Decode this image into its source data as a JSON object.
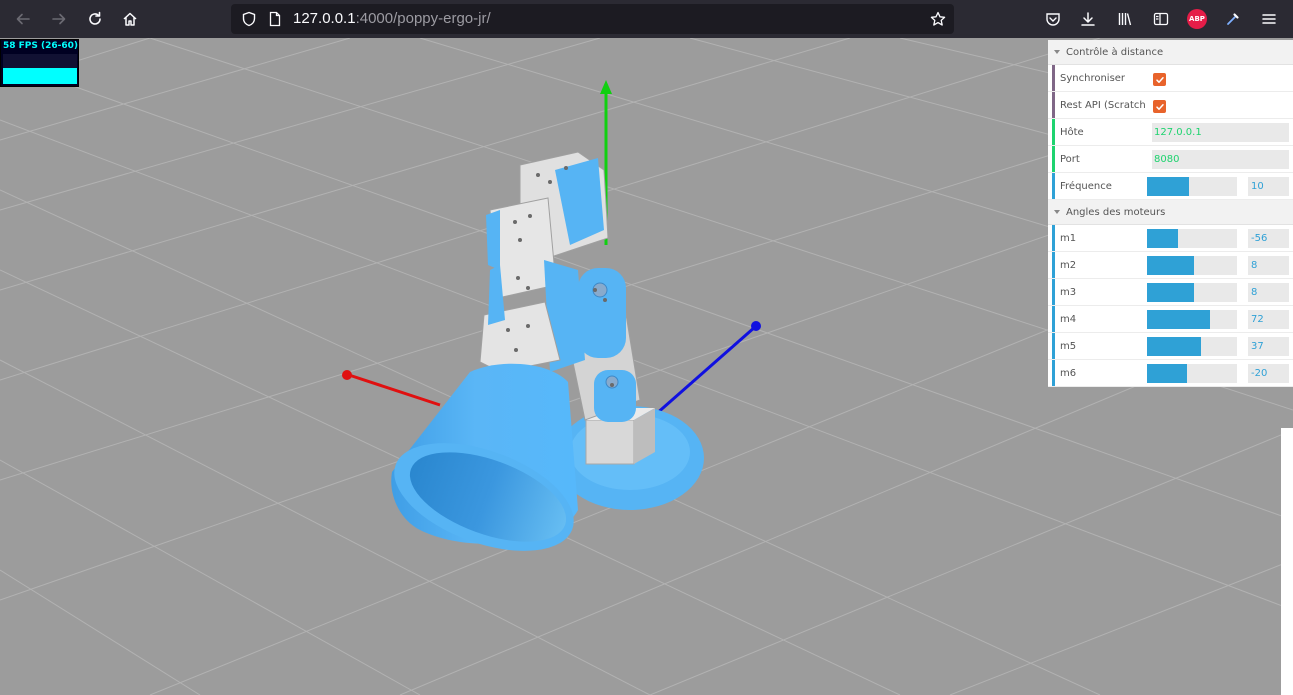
{
  "browser": {
    "url_host": "127.0.0.1",
    "url_rest": ":4000/poppy-ergo-jr/",
    "abp_label": "ABP"
  },
  "stats": {
    "fps_label": "58 FPS (26-60)"
  },
  "gui": {
    "remote_folder": {
      "title": "Contrôle à distance",
      "sync_label": "Synchroniser",
      "sync_checked": true,
      "rest_label": "Rest API (Scratch",
      "rest_checked": true,
      "host_label": "Hôte",
      "host_value": "127.0.0.1",
      "port_label": "Port",
      "port_value": "8080",
      "freq_label": "Fréquence",
      "freq_value": "10",
      "freq_fraction": 0.47
    },
    "motors_folder": {
      "title": "Angles des moteurs",
      "motors": [
        {
          "label": "m1",
          "value": "-56",
          "fraction": 0.34
        },
        {
          "label": "m2",
          "value": "8",
          "fraction": 0.52
        },
        {
          "label": "m3",
          "value": "8",
          "fraction": 0.52
        },
        {
          "label": "m4",
          "value": "72",
          "fraction": 0.7
        },
        {
          "label": "m5",
          "value": "37",
          "fraction": 0.6
        },
        {
          "label": "m6",
          "value": "-20",
          "fraction": 0.44
        }
      ]
    }
  },
  "colors": {
    "robot_blue": "#56b4f4",
    "robot_gray": "#d8d8d8",
    "axis_x": "#e01010",
    "axis_y": "#10d010",
    "axis_z": "#1010e0",
    "floor": "#9c9c9c"
  }
}
